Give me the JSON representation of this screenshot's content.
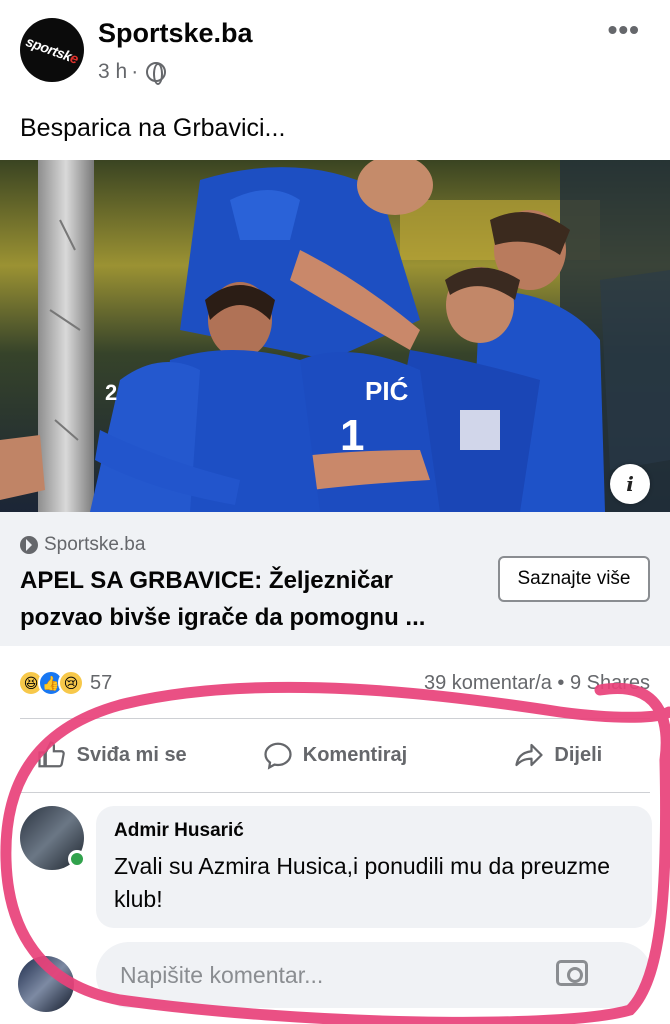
{
  "post": {
    "page_name": "Sportske.ba",
    "time": "3 h",
    "dot": "·",
    "avatar_text": "sportsk",
    "avatar_text_accent": "e",
    "more": "•••",
    "text": "Besparica na Grbavici...",
    "privacy_icon": "globe-icon"
  },
  "photo": {
    "jersey_text_1": "PIĆ",
    "jersey_number_1": "2",
    "jersey_number_2": "1",
    "info_label": "i"
  },
  "link": {
    "domain": "Sportske.ba",
    "title": "APEL SA GRBAVICE: Željezničar pozvao bivše igrače da pomognu ...",
    "button": "Saznajte više"
  },
  "stats": {
    "reaction_count": "57",
    "reactions": [
      "haha-icon",
      "like-icon",
      "sad-icon"
    ],
    "comments_shares": "39 komentar/a • 9 Shares"
  },
  "actions": {
    "like": "Sviđa mi se",
    "comment": "Komentiraj",
    "share": "Dijeli"
  },
  "comment": {
    "author": "Admir Husarić",
    "text": "Zvali su Azmira Husica,i ponudili mu da preuzme klub!"
  },
  "composer": {
    "placeholder": "Napišite komentar..."
  },
  "colors": {
    "brand": "#1877f2",
    "annotation": "#e8417a",
    "secondary_text": "#65676b"
  }
}
